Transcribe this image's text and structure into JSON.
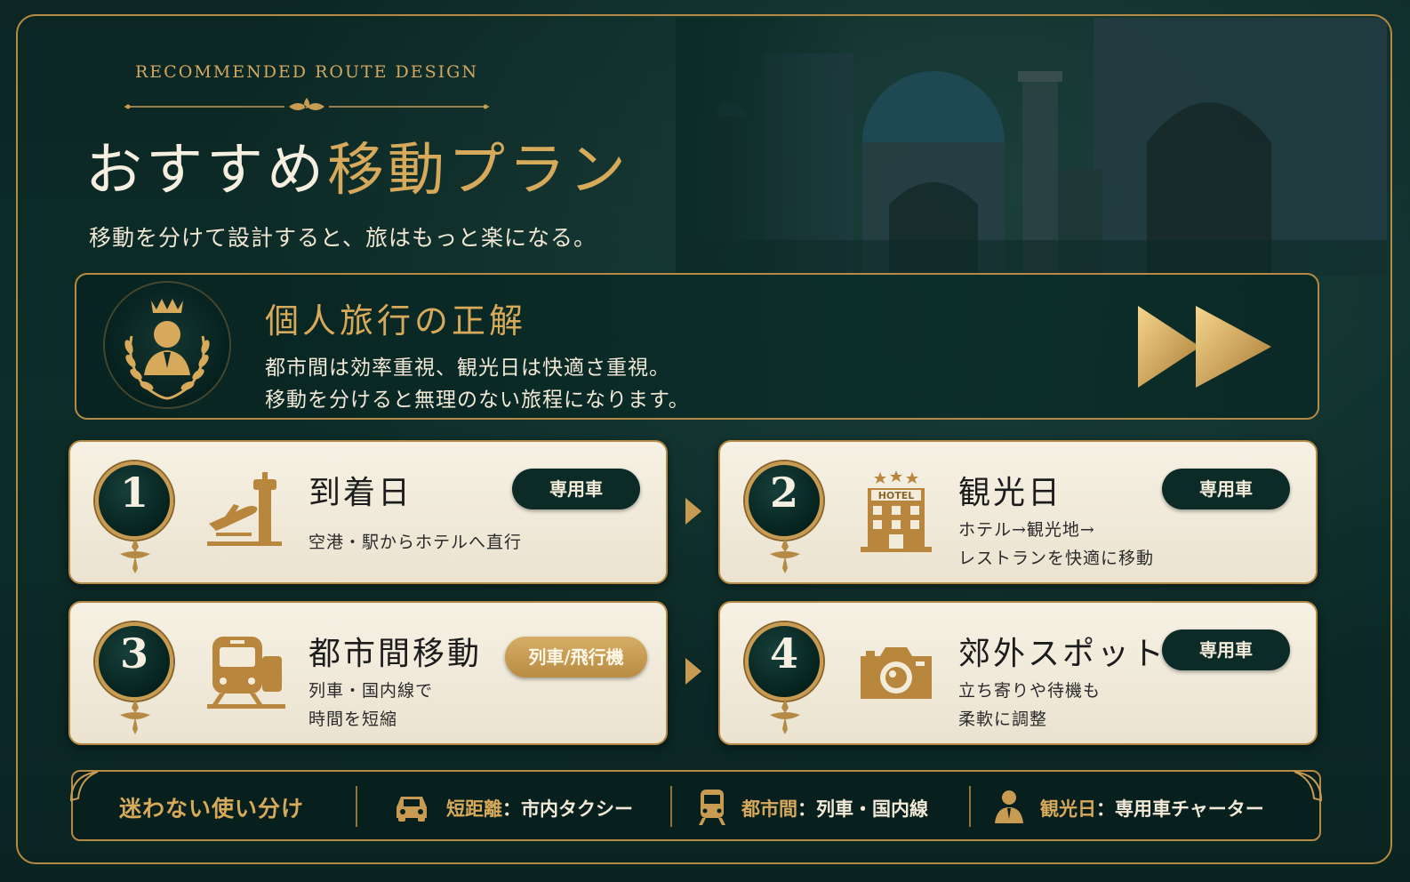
{
  "header": {
    "eyebrow": "RECOMMENDED ROUTE DESIGN",
    "title_part1": "おすすめ",
    "title_part2": "移動プラン",
    "subtitle": "移動を分けて設計すると、旅はもっと楽になる。"
  },
  "hero": {
    "title": "個人旅行の正解",
    "line1": "都市間は効率重視、観光日は快適さ重視。",
    "line2": "移動を分けると無理のない旅程になります。"
  },
  "cards": [
    {
      "number": "1",
      "title": "到着日",
      "desc1": "空港・駅からホテルへ直行",
      "desc2": "",
      "badge": "専用車",
      "icon": "airplane-departure-icon"
    },
    {
      "number": "2",
      "title": "観光日",
      "desc1": "ホテル→観光地→",
      "desc2": "レストランを快適に移動",
      "badge": "専用車",
      "icon": "hotel-icon",
      "icon_text": "HOTEL"
    },
    {
      "number": "3",
      "title": "都市間移動",
      "desc1": "列車・国内線で",
      "desc2": "時間を短縮",
      "badge": "列車/飛行機",
      "icon": "train-icon"
    },
    {
      "number": "4",
      "title": "郊外スポット",
      "desc1": "立ち寄りや待機も",
      "desc2": "柔軟に調整",
      "badge": "専用車",
      "icon": "camera-icon"
    }
  ],
  "bottom": {
    "title": "迷わない使い分け",
    "items": [
      {
        "key": "短距離",
        "value": "：市内タクシー",
        "icon": "taxi-icon"
      },
      {
        "key": "都市間",
        "value": "：列車・国内線",
        "icon": "train-icon"
      },
      {
        "key": "観光日",
        "value": "：専用車チャーター",
        "icon": "chauffeur-icon"
      }
    ]
  },
  "colors": {
    "gold": "#d7a95a",
    "dark_green": "#0c2b27",
    "cream": "#f6f1e4"
  }
}
